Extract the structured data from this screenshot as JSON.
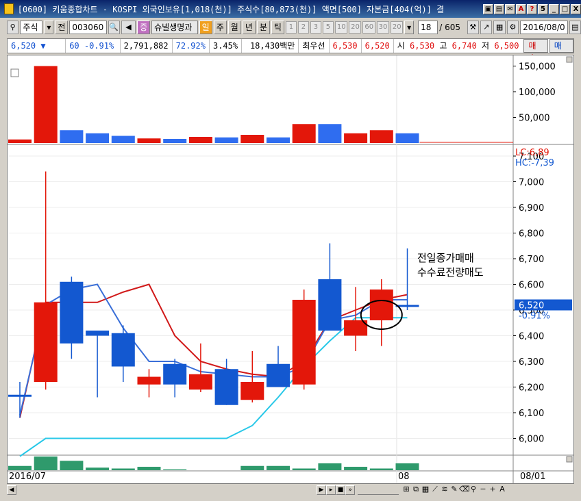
{
  "window": {
    "title": "[0600] 키움종합차트 - KOSPI 외국인보유[1,018(천)] 주식수[80,873(천)] 액면[500] 자본금[404(억)] 결",
    "buttons": [
      "5",
      "_",
      "□",
      "X"
    ]
  },
  "toolbar": {
    "market": "주식",
    "jeon": "전",
    "code": "003060",
    "zeung": "증",
    "name": "슈넬생명과",
    "periods_active": [
      "일",
      "주",
      "월",
      "년",
      "분",
      "틱"
    ],
    "periods_minor": [
      "1",
      "2",
      "3",
      "5",
      "10",
      "20",
      "60",
      "30",
      "20"
    ],
    "count": "18",
    "total": "/ 605",
    "date": "2016/08/0"
  },
  "quote": {
    "price": "6,520 ▼",
    "change": "60 -0.91%",
    "volume": "2,791,882",
    "ratio": "72.92%",
    "turnover": "3.45%",
    "amount": "18,430백만",
    "best_label": "최우선",
    "ask": "6,530",
    "bid": "6,520",
    "open_label": "시",
    "open": "6,530",
    "high_label": "고",
    "high": "6,740",
    "low_label": "저",
    "low": "6,500",
    "buy_button": "매수",
    "sell_button": "매도"
  },
  "chart_data": {
    "type": "candlestick",
    "annotation": [
      "전일종가매매",
      "수수료전량매도"
    ],
    "legend": [
      "LC:6,89",
      "HC:-7,39"
    ],
    "current_price": "6,520",
    "current_change": "-0.91%",
    "date_start": "2016/07",
    "date_mid": "08",
    "date_end": "08/01",
    "price_axis": {
      "ylim": [
        5940,
        7140
      ],
      "ticks": [
        "7,100",
        "7,000",
        "6,900",
        "6,800",
        "6,700",
        "6,600",
        "6,500",
        "6,400",
        "6,300",
        "6,200",
        "6,100",
        "6,000"
      ],
      "tick_values": [
        7100,
        7000,
        6900,
        6800,
        6700,
        6600,
        6500,
        6400,
        6300,
        6200,
        6100,
        6000
      ]
    },
    "volume_axis": {
      "ylim": [
        0,
        160000
      ],
      "ticks": [
        "150,000",
        "100,000",
        "50,000"
      ],
      "tick_values": [
        150000,
        100000,
        50000
      ]
    },
    "candles": [
      {
        "o": 6170,
        "c": 6170,
        "h": 6220,
        "l": 6080,
        "up": false
      },
      {
        "o": 6220,
        "c": 6530,
        "h": 7040,
        "l": 6190,
        "up": true
      },
      {
        "o": 6610,
        "c": 6370,
        "h": 6630,
        "l": 6310,
        "up": false
      },
      {
        "o": 6420,
        "c": 6400,
        "h": 6420,
        "l": 6160,
        "up": false
      },
      {
        "o": 6410,
        "c": 6280,
        "h": 6440,
        "l": 6220,
        "up": false
      },
      {
        "o": 6210,
        "c": 6240,
        "h": 6270,
        "l": 6160,
        "up": true
      },
      {
        "o": 6290,
        "c": 6210,
        "h": 6310,
        "l": 6160,
        "up": false
      },
      {
        "o": 6190,
        "c": 6250,
        "h": 6370,
        "l": 6180,
        "up": true
      },
      {
        "o": 6270,
        "c": 6130,
        "h": 6310,
        "l": 6130,
        "up": false
      },
      {
        "o": 6150,
        "c": 6220,
        "h": 6340,
        "l": 6140,
        "up": true
      },
      {
        "o": 6290,
        "c": 6200,
        "h": 6360,
        "l": 6200,
        "up": false
      },
      {
        "o": 6210,
        "c": 6540,
        "h": 6580,
        "l": 6190,
        "up": true
      },
      {
        "o": 6620,
        "c": 6420,
        "h": 6760,
        "l": 6420,
        "up": false
      },
      {
        "o": 6400,
        "c": 6460,
        "h": 6590,
        "l": 6340,
        "up": true
      },
      {
        "o": 6460,
        "c": 6580,
        "h": 6620,
        "l": 6360,
        "up": true
      },
      {
        "o": 6520,
        "c": 6520,
        "h": 6740,
        "l": 6500,
        "up": false
      }
    ],
    "volumes": [
      {
        "v": 7000,
        "up": true
      },
      {
        "v": 150000,
        "up": true
      },
      {
        "v": 25000,
        "up": false
      },
      {
        "v": 19000,
        "up": false
      },
      {
        "v": 14000,
        "up": false
      },
      {
        "v": 9000,
        "up": true
      },
      {
        "v": 8000,
        "up": false
      },
      {
        "v": 12000,
        "up": true
      },
      {
        "v": 11000,
        "up": false
      },
      {
        "v": 16000,
        "up": true
      },
      {
        "v": 11000,
        "up": false
      },
      {
        "v": 37000,
        "up": true
      },
      {
        "v": 37000,
        "up": false
      },
      {
        "v": 19000,
        "up": true
      },
      {
        "v": 25000,
        "up": true
      },
      {
        "v": 19000,
        "up": false
      }
    ],
    "ma_red": [
      6080,
      6530,
      6530,
      6530,
      6570,
      6600,
      6400,
      6300,
      6270,
      6250,
      6240,
      6300,
      6460,
      6500,
      6540,
      6560
    ],
    "ma_blue": [
      6090,
      6520,
      6580,
      6600,
      6430,
      6300,
      6300,
      6260,
      6250,
      6240,
      6240,
      6280,
      6460,
      6480,
      6540,
      6540
    ],
    "ma_cyan": [
      5930,
      6000,
      6000,
      6000,
      6000,
      6000,
      6000,
      6000,
      6000,
      6050,
      6160,
      6280,
      6380,
      6470,
      6470,
      6470
    ],
    "sub_volume": [
      5,
      16,
      11,
      3,
      2,
      4,
      1,
      0,
      0,
      5,
      5,
      2,
      8,
      4,
      2,
      8
    ]
  },
  "colors": {
    "up": "#e3170a",
    "down": "#1358d0",
    "ma_red": "#d11a1a",
    "ma_blue": "#3a6fd8",
    "ma_cyan": "#28c8e8",
    "sub_bar": "#2f9a6c",
    "vol_up": "#e3170a",
    "vol_down": "#2f6df0"
  }
}
